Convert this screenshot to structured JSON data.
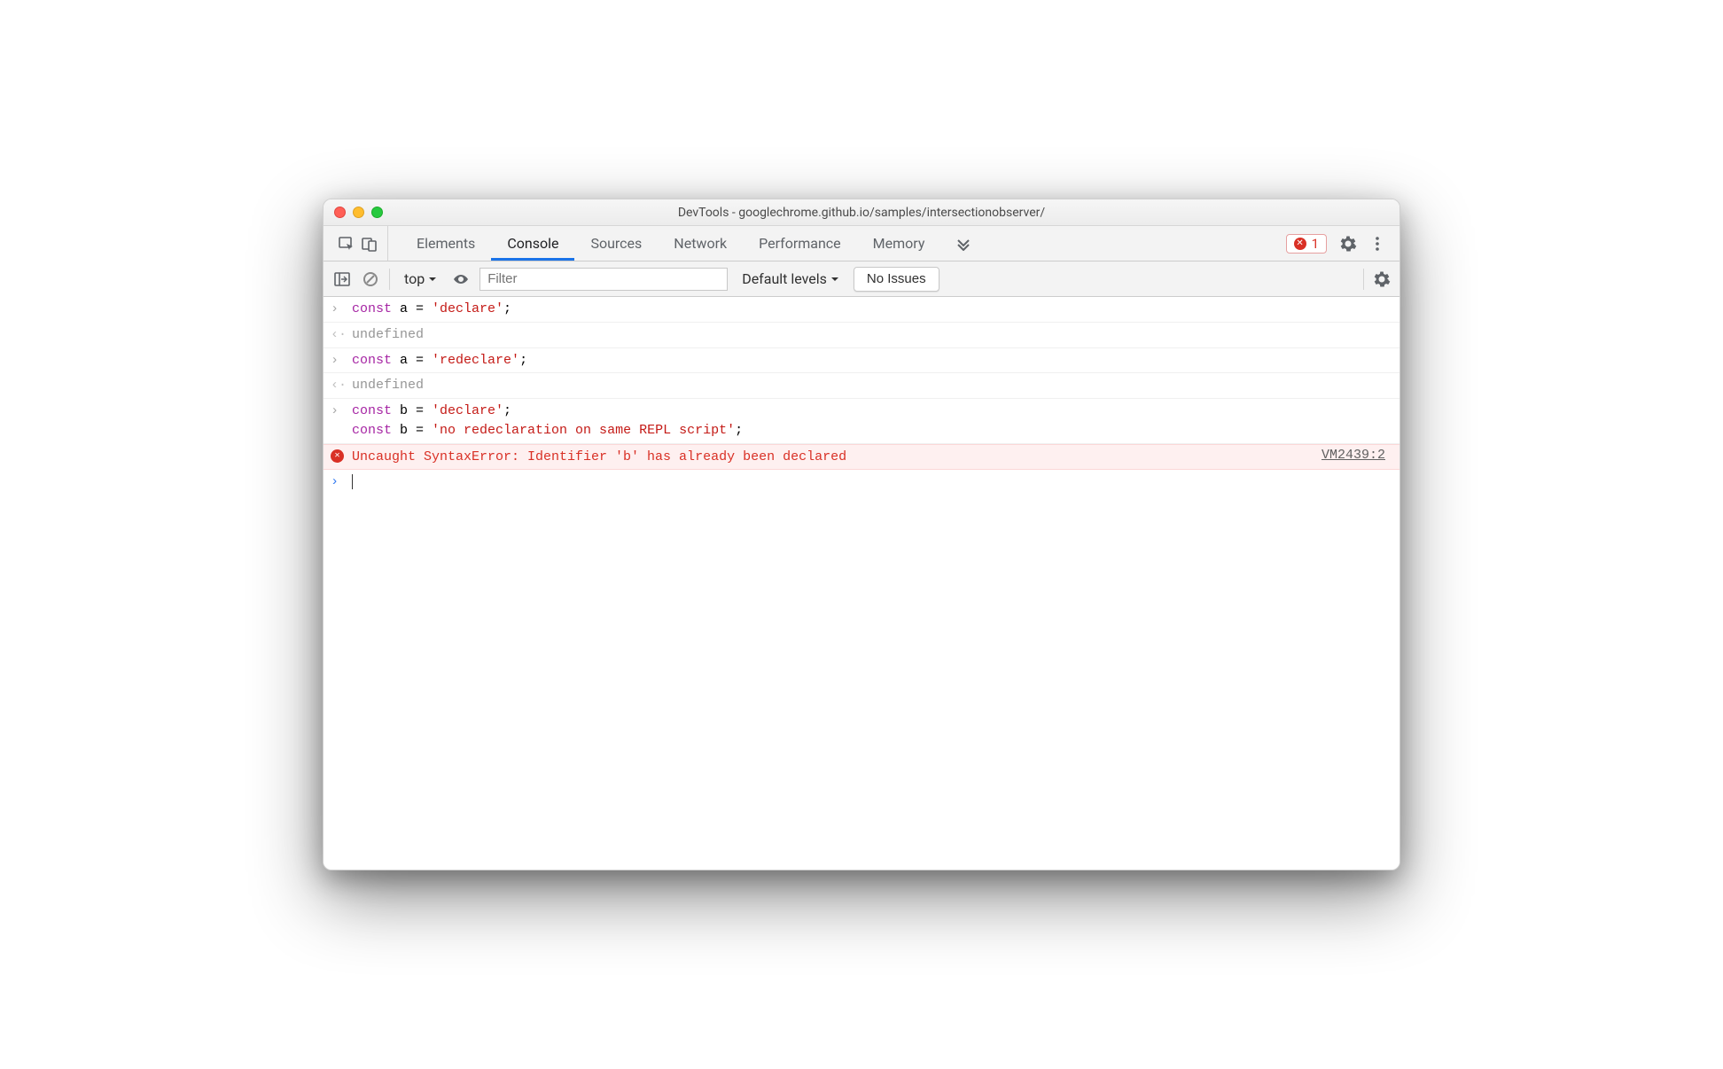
{
  "title": "DevTools - googlechrome.github.io/samples/intersectionobserver/",
  "tabs": {
    "elements": "Elements",
    "console": "Console",
    "sources": "Sources",
    "network": "Network",
    "performance": "Performance",
    "memory": "Memory"
  },
  "error_count": "1",
  "filterbar": {
    "context": "top",
    "filter_placeholder": "Filter",
    "levels": "Default levels",
    "issues": "No Issues"
  },
  "console": {
    "line1_kw": "const",
    "line1_rest": " a = ",
    "line1_str": "'declare'",
    "line1_end": ";",
    "undef1": "undefined",
    "line2_kw": "const",
    "line2_rest": " a = ",
    "line2_str": "'redeclare'",
    "line2_end": ";",
    "undef2": "undefined",
    "line3a_kw": "const",
    "line3a_rest": " b = ",
    "line3a_str": "'declare'",
    "line3a_end": ";",
    "line3b_kw": "const",
    "line3b_rest": " b = ",
    "line3b_str": "'no redeclaration on same REPL script'",
    "line3b_end": ";",
    "error_text": "Uncaught SyntaxError: Identifier 'b' has already been declared",
    "error_src": "VM2439:2"
  }
}
